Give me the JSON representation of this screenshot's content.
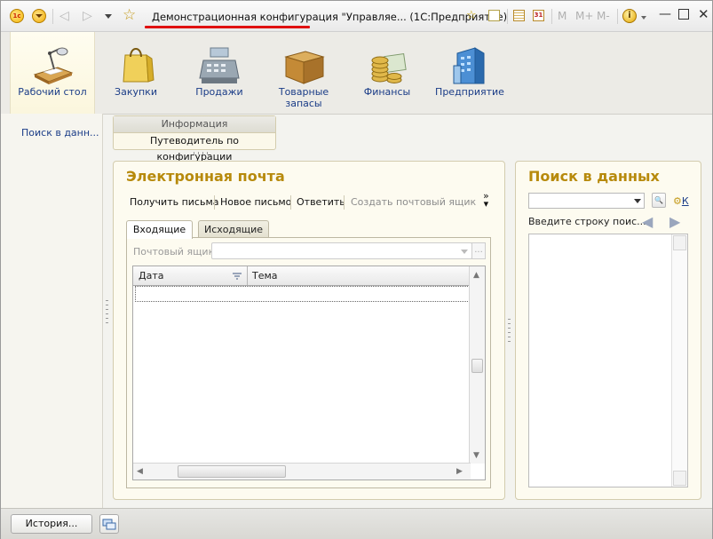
{
  "titlebar": {
    "title": "Демонстрационная конфигурация \"Управляе...  (1С:Предприятие)",
    "logo_text": "1c",
    "icons": [
      "app-logo-icon",
      "main-menu-icon",
      "back-icon",
      "forward-icon",
      "history-dropdown-icon",
      "favorites-star-icon",
      "add-to-favorites-icon",
      "favorites-list-icon",
      "calculator-icon",
      "calendar-icon",
      "info-icon"
    ],
    "calendar_day": "31",
    "memory_buttons": [
      "M",
      "M+",
      "M-"
    ]
  },
  "sections": [
    {
      "label": "Рабочий стол",
      "icon": "desktop-lamp-icon"
    },
    {
      "label": "Закупки",
      "icon": "shopping-bag-icon"
    },
    {
      "label": "Продажи",
      "icon": "cash-register-icon"
    },
    {
      "label": "Товарные запасы",
      "icon": "inventory-box-icon"
    },
    {
      "label": "Финансы",
      "icon": "coins-icon"
    },
    {
      "label": "Предприятие",
      "icon": "building-icon"
    }
  ],
  "leftnav": {
    "items": [
      {
        "label": "Поиск в данн..."
      }
    ]
  },
  "info_panel": {
    "header": "Информация",
    "link": "Путеводитель по конфигурации"
  },
  "email": {
    "title": "Электронная почта",
    "commands": [
      {
        "label": "Получить письма",
        "enabled": true
      },
      {
        "label": "Новое письмо",
        "enabled": true
      },
      {
        "label": "Ответить",
        "enabled": true
      },
      {
        "label": "Создать почтовый ящик",
        "enabled": false
      }
    ],
    "tabs": [
      {
        "label": "Входящие",
        "active": true
      },
      {
        "label": "Исходящие",
        "active": false
      }
    ],
    "mailbox_label": "Почтовый ящик:",
    "mailbox_value": "",
    "mailbox_choose": "...",
    "columns": [
      "Дата",
      "Тема"
    ]
  },
  "search": {
    "title": "Поиск в данных",
    "query": "",
    "link": "К",
    "hint": "Введите строку поис..."
  },
  "statusbar": {
    "history_label": "История..."
  }
}
